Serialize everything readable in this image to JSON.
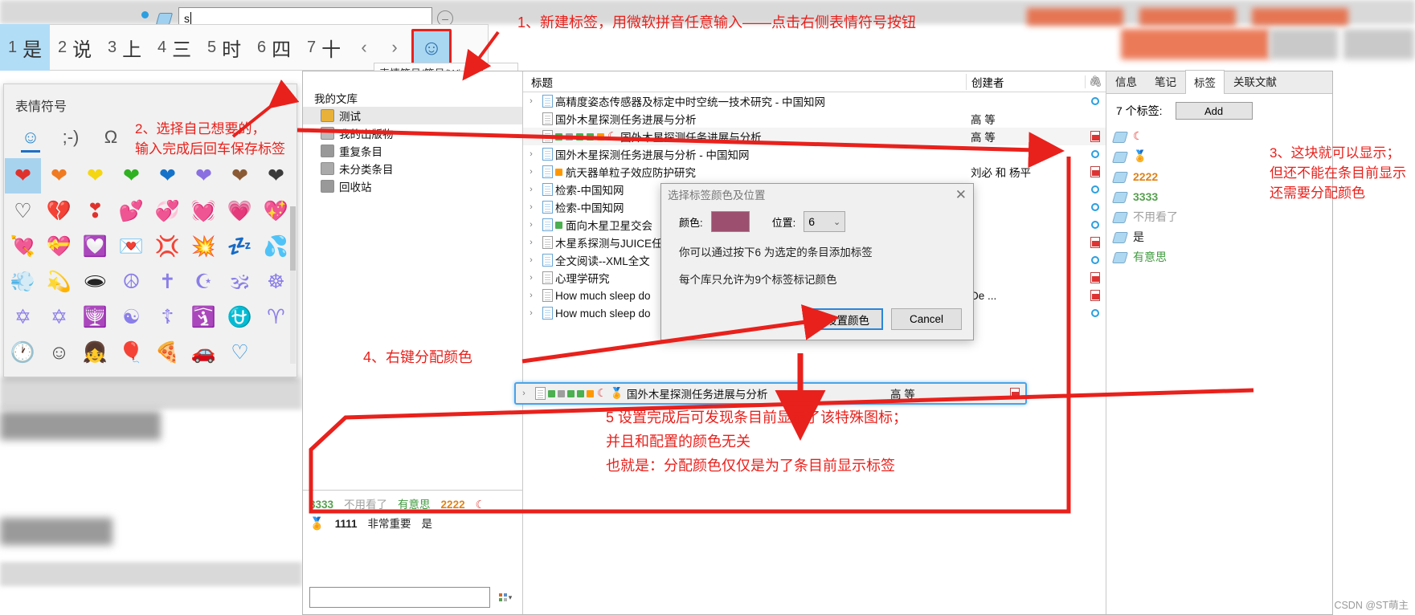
{
  "ime": {
    "input_value": "s",
    "tag_icon": "tag-icon",
    "minus_icon": "minus-circle-icon",
    "candidates": [
      {
        "num": "1",
        "word": "是",
        "selected": true
      },
      {
        "num": "2",
        "word": "说",
        "selected": false
      },
      {
        "num": "3",
        "word": "上",
        "selected": false
      },
      {
        "num": "4",
        "word": "三",
        "selected": false
      },
      {
        "num": "5",
        "word": "时",
        "selected": false
      },
      {
        "num": "6",
        "word": "四",
        "selected": false
      },
      {
        "num": "7",
        "word": "十",
        "selected": false
      }
    ],
    "prev_label": "‹",
    "next_label": "›",
    "emoji_button_glyph": "☺",
    "tooltip": "表情符号/符号(Win + .)"
  },
  "emoji_panel": {
    "title": "表情符号",
    "close_label": "✕",
    "categories": [
      {
        "name": "emoji-category",
        "glyph": "☺",
        "active": true
      },
      {
        "name": "kaomoji-category",
        "glyph": ";-)",
        "active": false
      },
      {
        "name": "symbols-category",
        "glyph": "Ω",
        "active": false
      }
    ],
    "grid": [
      {
        "glyph": "❤",
        "color": "#e0322c",
        "selected": true
      },
      {
        "glyph": "❤",
        "color": "#ef7a21",
        "selected": false
      },
      {
        "glyph": "❤",
        "color": "#f4d712",
        "selected": false
      },
      {
        "glyph": "❤",
        "color": "#2fb122",
        "selected": false
      },
      {
        "glyph": "❤",
        "color": "#1473c8",
        "selected": false
      },
      {
        "glyph": "❤",
        "color": "#8a6fe0",
        "selected": false
      },
      {
        "glyph": "❤",
        "color": "#8a5a35",
        "selected": false
      },
      {
        "glyph": "❤",
        "color": "#3b3b3b",
        "selected": false
      },
      {
        "glyph": "♡",
        "color": "#f2f2f2",
        "selected": false
      },
      {
        "glyph": "💔",
        "color": "#e0322c",
        "selected": false
      },
      {
        "glyph": "❣",
        "color": "#e0322c",
        "selected": false
      },
      {
        "glyph": "💕",
        "color": "#ef6a82",
        "selected": false
      },
      {
        "glyph": "💞",
        "color": "#d22b2b",
        "selected": false
      },
      {
        "glyph": "💓",
        "color": "#e0322c",
        "selected": false
      },
      {
        "glyph": "💗",
        "color": "#f2859e",
        "selected": false
      },
      {
        "glyph": "💖",
        "color": "#e0322c",
        "selected": false
      },
      {
        "glyph": "💘",
        "color": "#e0322c",
        "selected": false
      },
      {
        "glyph": "💝",
        "color": "#e0322c",
        "selected": false
      },
      {
        "glyph": "💟",
        "color": "#f2859e",
        "selected": false
      },
      {
        "glyph": "💌",
        "color": "#cfe6f7",
        "selected": false
      },
      {
        "glyph": "💢",
        "color": "#d02626",
        "selected": false
      },
      {
        "glyph": "💥",
        "color": "#e0322c",
        "selected": false
      },
      {
        "glyph": "💤",
        "color": "#1f9be0",
        "selected": false
      },
      {
        "glyph": "💦",
        "color": "#1f9be0",
        "selected": false
      },
      {
        "glyph": "💨",
        "color": "#eeeeee",
        "selected": false
      },
      {
        "glyph": "💫",
        "color": "#1f9be0",
        "selected": false
      },
      {
        "glyph": "🕳",
        "color": "#222222",
        "selected": false
      },
      {
        "glyph": "☮",
        "color": "#8a7ee8",
        "selected": false
      },
      {
        "glyph": "✝",
        "color": "#8a7ee8",
        "selected": false
      },
      {
        "glyph": "☪",
        "color": "#8a7ee8",
        "selected": false
      },
      {
        "glyph": "🕉",
        "color": "#8a7ee8",
        "selected": false
      },
      {
        "glyph": "☸",
        "color": "#8a7ee8",
        "selected": false
      },
      {
        "glyph": "✡",
        "color": "#8a7ee8",
        "selected": false
      },
      {
        "glyph": "✡",
        "color": "#8a7ee8",
        "selected": false
      },
      {
        "glyph": "🕎",
        "color": "#8a7ee8",
        "selected": false
      },
      {
        "glyph": "☯",
        "color": "#8a7ee8",
        "selected": false
      },
      {
        "glyph": "☦",
        "color": "#8a7ee8",
        "selected": false
      },
      {
        "glyph": "🛐",
        "color": "#8a7ee8",
        "selected": false
      },
      {
        "glyph": "⛎",
        "color": "#8a7ee8",
        "selected": false
      },
      {
        "glyph": "♈",
        "color": "#8a7ee8",
        "selected": false
      },
      {
        "glyph": "🕐",
        "color": "#ffffff",
        "selected": false
      },
      {
        "glyph": "☺",
        "color": "#ffffff",
        "selected": false
      },
      {
        "glyph": "👧",
        "color": "#ffffff",
        "selected": false
      },
      {
        "glyph": "🎈",
        "color": "#ffffff",
        "selected": false
      },
      {
        "glyph": "🍕",
        "color": "#ffffff",
        "selected": false
      },
      {
        "glyph": "🚗",
        "color": "#ffffff",
        "selected": false
      },
      {
        "glyph": "♡",
        "color": "#1f8ad8",
        "selected": false
      }
    ]
  },
  "zotero": {
    "collections": [
      {
        "label": "我的文库",
        "icon": "library-icon",
        "selected": false,
        "root": true
      },
      {
        "label": "测试",
        "icon": "folder-icon",
        "selected": true,
        "root": false
      },
      {
        "label": "我的出版物",
        "icon": "publications-icon",
        "selected": false,
        "root": false
      },
      {
        "label": "重复条目",
        "icon": "duplicates-icon",
        "selected": false,
        "root": false
      },
      {
        "label": "未分类条目",
        "icon": "unfiled-icon",
        "selected": false,
        "root": false
      },
      {
        "label": "回收站",
        "icon": "trash-icon",
        "selected": false,
        "root": false
      }
    ],
    "tag_selector": {
      "row1": [
        {
          "label": "3333",
          "color": "#57a050"
        },
        {
          "label": "不用看了",
          "color": "#a0a0a0"
        },
        {
          "label": "有意思",
          "color": "#3f9b3f"
        },
        {
          "label": "2222",
          "color": "#e08218"
        },
        {
          "label": "☾",
          "color": "#e0322c"
        }
      ],
      "row2": [
        {
          "label": "🏅",
          "color": "#d4a017"
        },
        {
          "label": "1111",
          "color": "#222222"
        },
        {
          "label": "非常重要",
          "color": "#222222"
        },
        {
          "label": "是",
          "color": "#222222"
        }
      ],
      "search_placeholder": "",
      "menu_icon": "tag-options-icon"
    },
    "items": {
      "columns": {
        "title": "标题",
        "creator": "创建者",
        "attachment": "attachment-icon"
      },
      "rows": [
        {
          "title": "高精度姿态传感器及标定中时空统一技术研究 - 中国知网",
          "creator": "",
          "twisty": true,
          "icon": "blue-doc-icon",
          "markers": [],
          "attach": "sync-dot-icon",
          "alt": false,
          "selected": false
        },
        {
          "title": "国外木星探测任务进展与分析",
          "creator": "高 等",
          "twisty": false,
          "icon": "gray-doc-icon",
          "markers": [],
          "attach": "",
          "alt": false,
          "selected": false
        },
        {
          "title": "国外木星探测任务进展与分析",
          "creator": "高 等",
          "twisty": true,
          "icon": "gray-doc-icon",
          "markers": [
            "#4caf50",
            "#9e9e9e",
            "#4caf50",
            "#4caf50",
            "#ff9800"
          ],
          "emoji": "☾",
          "attach": "pdf-icon",
          "alt": true,
          "selected": false
        },
        {
          "title": "国外木星探测任务进展与分析 - 中国知网",
          "creator": "",
          "twisty": true,
          "icon": "blue-doc-icon",
          "markers": [],
          "attach": "sync-dot-icon",
          "alt": false,
          "selected": false
        },
        {
          "title": "航天器单粒子效应防护研究",
          "creator": "刘必 和 杨平",
          "twisty": true,
          "icon": "blue-doc-icon",
          "markers": [
            "#ff9800"
          ],
          "attach": "pdf-icon",
          "alt": false,
          "selected": false
        },
        {
          "title": "检索-中国知网",
          "creator": "",
          "twisty": true,
          "icon": "blue-doc-icon",
          "markers": [],
          "attach": "sync-dot-icon",
          "alt": false,
          "selected": false
        },
        {
          "title": "检索-中国知网",
          "creator": "",
          "twisty": true,
          "icon": "blue-doc-icon",
          "markers": [],
          "attach": "sync-dot-icon",
          "alt": false,
          "selected": false
        },
        {
          "title": "面向木星卫星交会",
          "creator": "",
          "twisty": true,
          "icon": "blue-doc-icon",
          "markers": [
            "#4caf50"
          ],
          "attach": "sync-dot-icon",
          "alt": false,
          "selected": false
        },
        {
          "title": "木星系探测与JUICE任",
          "creator": "",
          "twisty": true,
          "icon": "gray-doc-icon",
          "markers": [],
          "attach": "pdf-icon",
          "alt": false,
          "selected": false
        },
        {
          "title": "全文阅读--XML全文",
          "creator": "",
          "twisty": true,
          "icon": "blue-doc-icon",
          "markers": [],
          "attach": "sync-dot-icon",
          "alt": false,
          "selected": false
        },
        {
          "title": "心理学研究",
          "creator": "",
          "twisty": true,
          "icon": "gray-doc-icon",
          "markers": [],
          "attach": "pdf-icon",
          "alt": false,
          "selected": false
        },
        {
          "title": "How much sleep do",
          "creator": "De ...",
          "twisty": true,
          "icon": "gray-doc-icon",
          "markers": [],
          "attach": "pdf-icon",
          "alt": false,
          "selected": false
        },
        {
          "title": "How much sleep do",
          "creator": "",
          "twisty": true,
          "icon": "blue-doc-icon",
          "markers": [],
          "attach": "sync-dot-icon",
          "alt": false,
          "selected": false
        }
      ],
      "highlight_row": {
        "title": "国外木星探测任务进展与分析",
        "creator": "高 等",
        "markers": [
          "#4caf50",
          "#9e9e9e",
          "#4caf50",
          "#4caf50",
          "#ff9800"
        ],
        "emoji1": "☾",
        "emoji2": "🏅",
        "attach": "pdf-icon"
      }
    },
    "right_panel": {
      "tabs": [
        {
          "label": "信息",
          "active": false
        },
        {
          "label": "笔记",
          "active": false
        },
        {
          "label": "标签",
          "active": true
        },
        {
          "label": "关联文献",
          "active": false
        }
      ],
      "count_label": "7 个标签:",
      "add_label": "Add",
      "tags": [
        {
          "label": "☾",
          "color": "#e0322c"
        },
        {
          "label": "🏅",
          "color": "#d4a017"
        },
        {
          "label": "2222",
          "color": "#e08218"
        },
        {
          "label": "3333",
          "color": "#57a050"
        },
        {
          "label": "不用看了",
          "color": "#a0a0a0"
        },
        {
          "label": "是",
          "color": "#222222"
        },
        {
          "label": "有意思",
          "color": "#3f9b3f"
        }
      ]
    }
  },
  "dialog": {
    "title": "选择标签颜色及位置",
    "close_label": "✕",
    "color_label": "颜色:",
    "color_value": "#9c4f6e",
    "position_label": "位置:",
    "position_value": "6",
    "chevron": "⌄",
    "hint1": "你可以通过按下6 为选定的条目添加标签",
    "hint2": "每个库只允许为9个标签标记颜色",
    "ok_label": "设置颜色",
    "cancel_label": "Cancel"
  },
  "annotations": {
    "a1": "1、新建标签，用微软拼音任意输入——点击右侧表情符号按钮",
    "a2": "2、选择自己想要的，\n输入完成后回车保存标签",
    "a3": "3、这块就可以显示；\n但还不能在条目前显示\n还需要分配颜色",
    "a4": "4、右键分配颜色",
    "a5": "5 设置完成后可发现条目前显示了该特殊图标；\n并且和配置的颜色无关\n也就是：分配颜色仅仅是为了条目前显示标签",
    "color": "#e8211c"
  },
  "watermark": "CSDN @ST萌主"
}
